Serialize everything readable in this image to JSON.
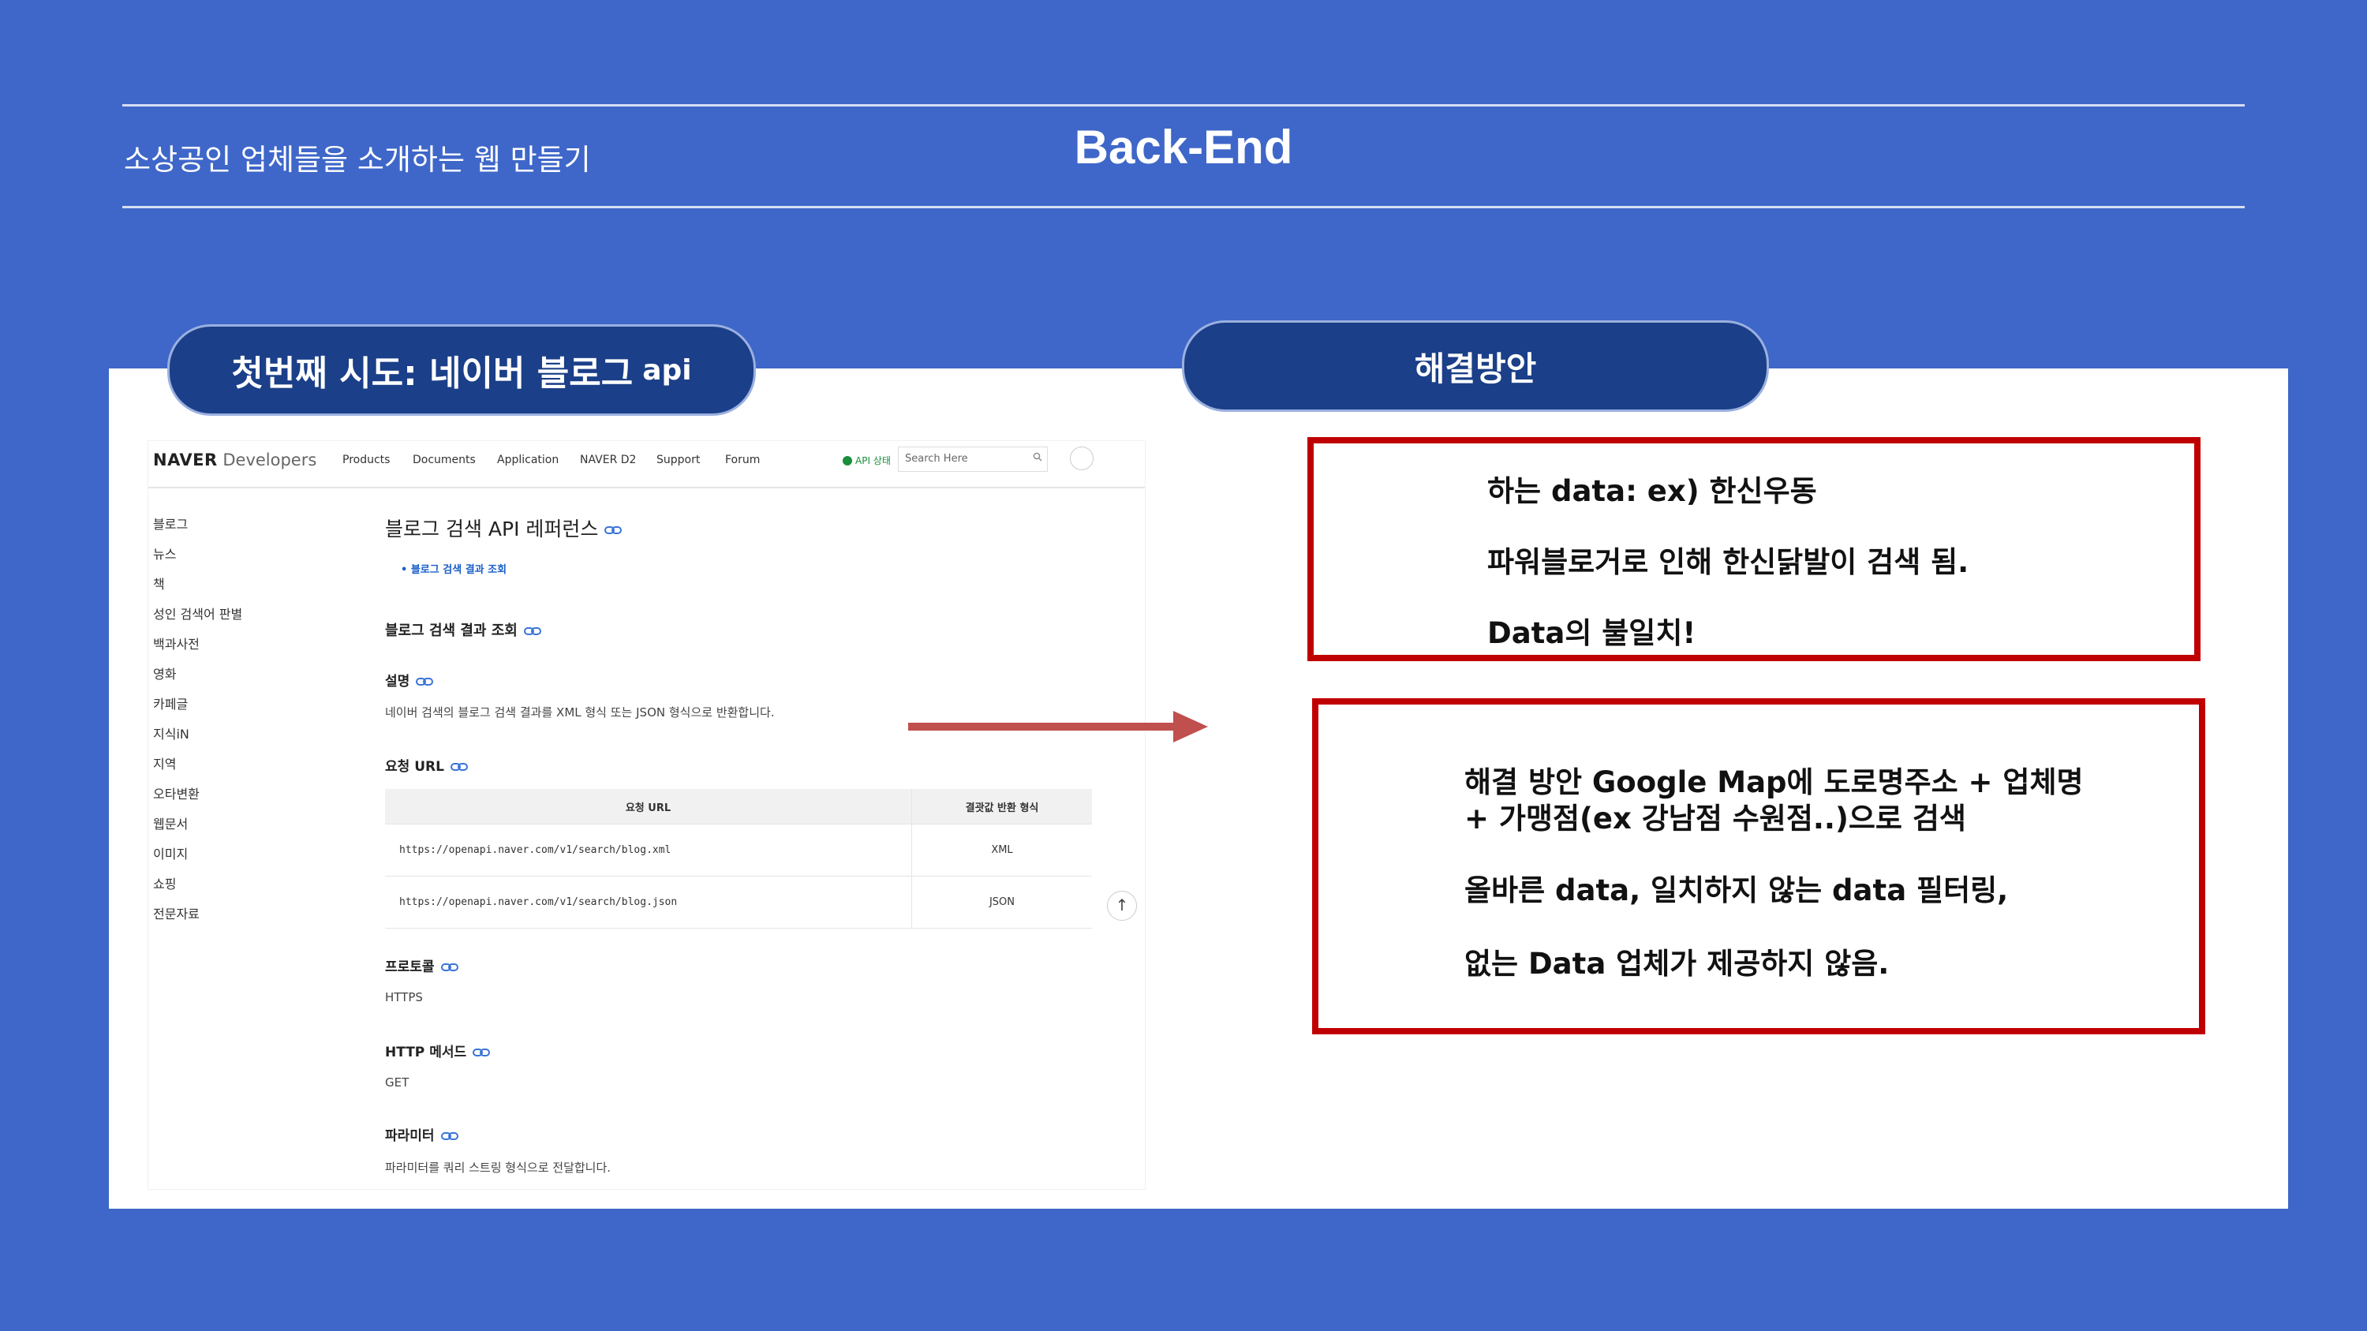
{
  "header": {
    "subtitle": "소상공인 업체들을 소개하는 웹 만들기",
    "title": "Back-End"
  },
  "left_pill": {
    "label": "첫번째 시도: 네이버 블로그",
    "api": "api"
  },
  "right_pill": {
    "label": "해결방안"
  },
  "box1": {
    "lines": [
      "하는 data: ex) 한신우동",
      "파워블로거로 인해 한신닭발이 검색 됨.",
      "Data의 불일치!"
    ]
  },
  "box2": {
    "lines": [
      "해결 방안 Google Map에 도로명주소 + 업체명",
      "+ 가맹점(ex 강남점 수원점..)으로 검색",
      "올바른 data, 일치하지 않는 data 필터링,",
      "없는 Data 업체가 제공하지 않음."
    ]
  },
  "naver": {
    "brand_bold": "NAVER",
    "brand_rest": "Developers",
    "nav": [
      "Products",
      "Documents",
      "Application",
      "NAVER D2",
      "Support",
      "Forum"
    ],
    "api_status": "API 상태",
    "search_placeholder": "Search Here",
    "sidebar": [
      "블로그",
      "뉴스",
      "책",
      "성인 검색어 판별",
      "백과사전",
      "영화",
      "카페글",
      "지식iN",
      "지역",
      "오타변환",
      "웹문서",
      "이미지",
      "쇼핑",
      "전문자료"
    ],
    "page_title": "블로그 검색 API 레퍼런스",
    "toc_item": "블로그 검색 결과 조회",
    "section_title": "블로그 검색 결과 조회",
    "desc_label": "설명",
    "desc_text": "네이버 검색의 블로그 검색 결과를 XML 형식 또는 JSON 형식으로 반환합니다.",
    "url_label": "요청 URL",
    "table_headers": [
      "요청 URL",
      "결괏값 반환 형식"
    ],
    "table_rows": [
      [
        "https://openapi.naver.com/v1/search/blog.xml",
        "XML"
      ],
      [
        "https://openapi.naver.com/v1/search/blog.json",
        "JSON"
      ]
    ],
    "protocol_label": "프로토콜",
    "protocol_value": "HTTPS",
    "method_label": "HTTP 메서드",
    "method_value": "GET",
    "param_label": "파라미터",
    "param_text": "파라미터를 쿼리 스트링 형식으로 전달합니다."
  },
  "colors": {
    "background": "#3f67c9",
    "pill": "#1b3f88",
    "red_border": "#c00000",
    "arrow": "#c0504d"
  }
}
